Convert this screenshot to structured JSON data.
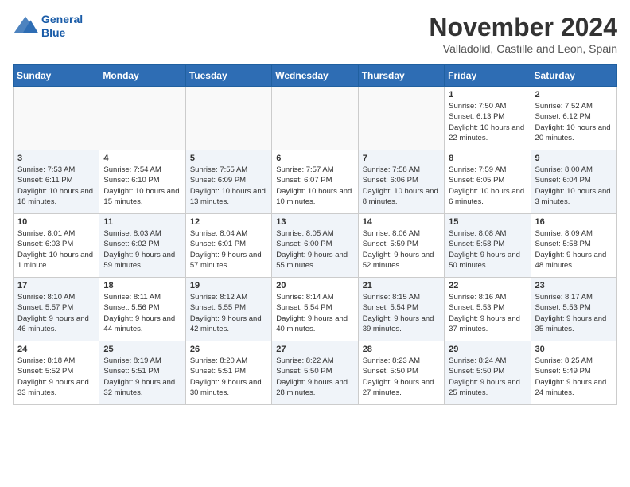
{
  "header": {
    "logo_line1": "General",
    "logo_line2": "Blue",
    "month": "November 2024",
    "location": "Valladolid, Castille and Leon, Spain"
  },
  "weekdays": [
    "Sunday",
    "Monday",
    "Tuesday",
    "Wednesday",
    "Thursday",
    "Friday",
    "Saturday"
  ],
  "weeks": [
    [
      {
        "day": "",
        "empty": true
      },
      {
        "day": "",
        "empty": true
      },
      {
        "day": "",
        "empty": true
      },
      {
        "day": "",
        "empty": true
      },
      {
        "day": "",
        "empty": true
      },
      {
        "day": "1",
        "sunrise": "Sunrise: 7:50 AM",
        "sunset": "Sunset: 6:13 PM",
        "daylight": "Daylight: 10 hours and 22 minutes."
      },
      {
        "day": "2",
        "sunrise": "Sunrise: 7:52 AM",
        "sunset": "Sunset: 6:12 PM",
        "daylight": "Daylight: 10 hours and 20 minutes."
      }
    ],
    [
      {
        "day": "3",
        "sunrise": "Sunrise: 7:53 AM",
        "sunset": "Sunset: 6:11 PM",
        "daylight": "Daylight: 10 hours and 18 minutes.",
        "shaded": true
      },
      {
        "day": "4",
        "sunrise": "Sunrise: 7:54 AM",
        "sunset": "Sunset: 6:10 PM",
        "daylight": "Daylight: 10 hours and 15 minutes."
      },
      {
        "day": "5",
        "sunrise": "Sunrise: 7:55 AM",
        "sunset": "Sunset: 6:09 PM",
        "daylight": "Daylight: 10 hours and 13 minutes.",
        "shaded": true
      },
      {
        "day": "6",
        "sunrise": "Sunrise: 7:57 AM",
        "sunset": "Sunset: 6:07 PM",
        "daylight": "Daylight: 10 hours and 10 minutes."
      },
      {
        "day": "7",
        "sunrise": "Sunrise: 7:58 AM",
        "sunset": "Sunset: 6:06 PM",
        "daylight": "Daylight: 10 hours and 8 minutes.",
        "shaded": true
      },
      {
        "day": "8",
        "sunrise": "Sunrise: 7:59 AM",
        "sunset": "Sunset: 6:05 PM",
        "daylight": "Daylight: 10 hours and 6 minutes."
      },
      {
        "day": "9",
        "sunrise": "Sunrise: 8:00 AM",
        "sunset": "Sunset: 6:04 PM",
        "daylight": "Daylight: 10 hours and 3 minutes.",
        "shaded": true
      }
    ],
    [
      {
        "day": "10",
        "sunrise": "Sunrise: 8:01 AM",
        "sunset": "Sunset: 6:03 PM",
        "daylight": "Daylight: 10 hours and 1 minute."
      },
      {
        "day": "11",
        "sunrise": "Sunrise: 8:03 AM",
        "sunset": "Sunset: 6:02 PM",
        "daylight": "Daylight: 9 hours and 59 minutes.",
        "shaded": true
      },
      {
        "day": "12",
        "sunrise": "Sunrise: 8:04 AM",
        "sunset": "Sunset: 6:01 PM",
        "daylight": "Daylight: 9 hours and 57 minutes."
      },
      {
        "day": "13",
        "sunrise": "Sunrise: 8:05 AM",
        "sunset": "Sunset: 6:00 PM",
        "daylight": "Daylight: 9 hours and 55 minutes.",
        "shaded": true
      },
      {
        "day": "14",
        "sunrise": "Sunrise: 8:06 AM",
        "sunset": "Sunset: 5:59 PM",
        "daylight": "Daylight: 9 hours and 52 minutes."
      },
      {
        "day": "15",
        "sunrise": "Sunrise: 8:08 AM",
        "sunset": "Sunset: 5:58 PM",
        "daylight": "Daylight: 9 hours and 50 minutes.",
        "shaded": true
      },
      {
        "day": "16",
        "sunrise": "Sunrise: 8:09 AM",
        "sunset": "Sunset: 5:58 PM",
        "daylight": "Daylight: 9 hours and 48 minutes."
      }
    ],
    [
      {
        "day": "17",
        "sunrise": "Sunrise: 8:10 AM",
        "sunset": "Sunset: 5:57 PM",
        "daylight": "Daylight: 9 hours and 46 minutes.",
        "shaded": true
      },
      {
        "day": "18",
        "sunrise": "Sunrise: 8:11 AM",
        "sunset": "Sunset: 5:56 PM",
        "daylight": "Daylight: 9 hours and 44 minutes."
      },
      {
        "day": "19",
        "sunrise": "Sunrise: 8:12 AM",
        "sunset": "Sunset: 5:55 PM",
        "daylight": "Daylight: 9 hours and 42 minutes.",
        "shaded": true
      },
      {
        "day": "20",
        "sunrise": "Sunrise: 8:14 AM",
        "sunset": "Sunset: 5:54 PM",
        "daylight": "Daylight: 9 hours and 40 minutes."
      },
      {
        "day": "21",
        "sunrise": "Sunrise: 8:15 AM",
        "sunset": "Sunset: 5:54 PM",
        "daylight": "Daylight: 9 hours and 39 minutes.",
        "shaded": true
      },
      {
        "day": "22",
        "sunrise": "Sunrise: 8:16 AM",
        "sunset": "Sunset: 5:53 PM",
        "daylight": "Daylight: 9 hours and 37 minutes."
      },
      {
        "day": "23",
        "sunrise": "Sunrise: 8:17 AM",
        "sunset": "Sunset: 5:53 PM",
        "daylight": "Daylight: 9 hours and 35 minutes.",
        "shaded": true
      }
    ],
    [
      {
        "day": "24",
        "sunrise": "Sunrise: 8:18 AM",
        "sunset": "Sunset: 5:52 PM",
        "daylight": "Daylight: 9 hours and 33 minutes."
      },
      {
        "day": "25",
        "sunrise": "Sunrise: 8:19 AM",
        "sunset": "Sunset: 5:51 PM",
        "daylight": "Daylight: 9 hours and 32 minutes.",
        "shaded": true
      },
      {
        "day": "26",
        "sunrise": "Sunrise: 8:20 AM",
        "sunset": "Sunset: 5:51 PM",
        "daylight": "Daylight: 9 hours and 30 minutes."
      },
      {
        "day": "27",
        "sunrise": "Sunrise: 8:22 AM",
        "sunset": "Sunset: 5:50 PM",
        "daylight": "Daylight: 9 hours and 28 minutes.",
        "shaded": true
      },
      {
        "day": "28",
        "sunrise": "Sunrise: 8:23 AM",
        "sunset": "Sunset: 5:50 PM",
        "daylight": "Daylight: 9 hours and 27 minutes."
      },
      {
        "day": "29",
        "sunrise": "Sunrise: 8:24 AM",
        "sunset": "Sunset: 5:50 PM",
        "daylight": "Daylight: 9 hours and 25 minutes.",
        "shaded": true
      },
      {
        "day": "30",
        "sunrise": "Sunrise: 8:25 AM",
        "sunset": "Sunset: 5:49 PM",
        "daylight": "Daylight: 9 hours and 24 minutes."
      }
    ]
  ]
}
